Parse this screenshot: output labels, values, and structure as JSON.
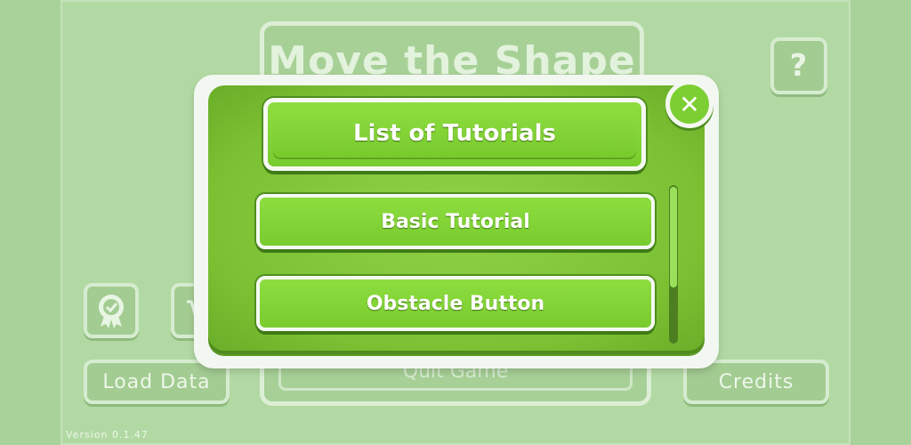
{
  "game": {
    "title": "Move the Shape",
    "version": "Version 0.1.47"
  },
  "background_buttons": {
    "help": "?",
    "load_data": "Load Data",
    "credits": "Credits",
    "quit": "Quit Game"
  },
  "modal": {
    "header": "List of Tutorials",
    "close": "✕",
    "items": [
      {
        "label": "Basic Tutorial"
      },
      {
        "label": "Obstacle Button"
      }
    ],
    "scroll_position": 0.0,
    "scroll_visible_fraction": 0.65
  },
  "colors": {
    "accent_green": "#7ccf33",
    "dim_background": "#b2d9a3"
  }
}
